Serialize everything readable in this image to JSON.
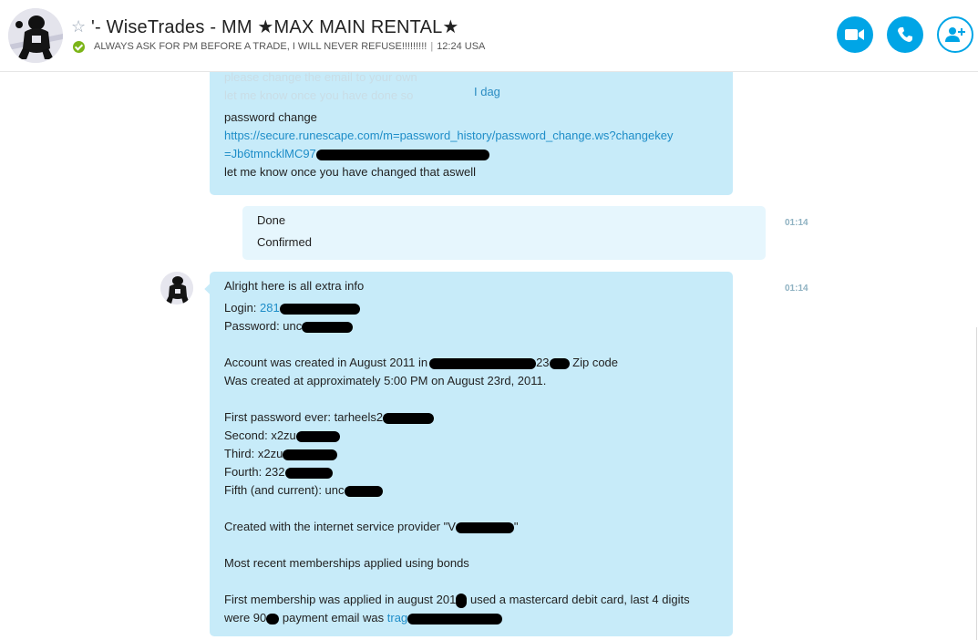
{
  "header": {
    "title": "'- WiseTrades - MM ★MAX MAIN RENTAL★",
    "mood": "ALWAYS ASK FOR PM BEFORE A TRADE, I WILL NEVER REFUSE!!!!!!!!!",
    "separator": "|",
    "local_time": "12:24 USA",
    "icons": [
      "star-icon",
      "online-status-icon",
      "video-call-icon",
      "audio-call-icon",
      "add-contact-icon"
    ],
    "accent_color": "#00a5e6"
  },
  "chat": {
    "date_divider": "I dag",
    "faded_lines": [
      "please change the email to your own",
      "let me know once you have done so"
    ],
    "message1": {
      "line1": "password change",
      "link_line1": "https://secure.runescape.com/m=password_history/password_change.ws?changekey",
      "link_line2": "=Jb6tmncklMC97",
      "line4": "let me know once you have changed that aswell"
    },
    "message2": {
      "line1": "Done",
      "line2": "Confirmed",
      "time": "01:14"
    },
    "message3": {
      "time": "01:14",
      "l1": "Alright here is all extra info",
      "login_label": "Login: ",
      "login_value": "281",
      "password_label": "Password: unc",
      "created_a": "Account was created in August 2011 in",
      "created_b": "23",
      "created_c": " Zip code",
      "created_time": "Was created at approximately 5:00 PM on August 23rd, 2011.",
      "first_pw": "First password ever: tarheels2",
      "second_pw": "Second: x2zu",
      "third_pw": "Third: x2zu",
      "fourth_pw": "Fourth: 232",
      "fifth_pw": "Fifth (and current): unc",
      "isp_a": "Created with the internet service provider \"V",
      "isp_b": "\"",
      "bonds": "Most recent memberships applied using bonds",
      "membership_a": "First membership was applied in august 201",
      "membership_b": " used a mastercard debit card, last 4 digits",
      "were_a": "were 90",
      "were_b": " payment email was ",
      "were_link": "trag"
    }
  }
}
